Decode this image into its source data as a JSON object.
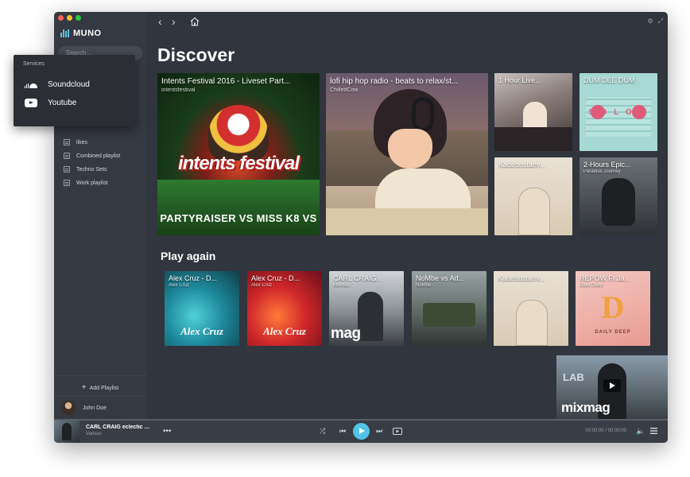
{
  "app": {
    "name": "MUNO",
    "search_placeholder": "Search..."
  },
  "colors": {
    "accent": "#4fc3e8",
    "window_bg": "#31353d",
    "sidebar_bg": "#353941"
  },
  "services_menu": {
    "title": "Services",
    "items": [
      {
        "label": "Soundcloud",
        "icon": "soundcloud-icon"
      },
      {
        "label": "Youtube",
        "icon": "youtube-icon"
      }
    ]
  },
  "sidebar": {
    "collection_label": "Your collection",
    "playlists": [
      {
        "label": "likes"
      },
      {
        "label": "Combined playlist"
      },
      {
        "label": "Techno Sets"
      },
      {
        "label": "Work playlist"
      }
    ],
    "add_playlist": "Add Playlist",
    "user_name": "John Doe"
  },
  "discover": {
    "heading": "Discover",
    "cards": [
      {
        "title": "Intents Festival 2016 - Liveset Part...",
        "subtitle": "intentsfestival",
        "art_text": "intents festival",
        "art_caption": "PARTYRAISER VS MISS K8 VS"
      },
      {
        "title": "lofi hip hop radio - beats to relax/st...",
        "subtitle": "ChilledCow"
      },
      {
        "title": "1 Hour Live...",
        "subtitle": ""
      },
      {
        "title": "DUM DEE DUM",
        "subtitle": "",
        "art_text": "S O L O W"
      },
      {
        "title": "Kadebostany...",
        "subtitle": ""
      },
      {
        "title": "2-Hours Epic...",
        "subtitle": "Paradise Journey"
      }
    ]
  },
  "play_again": {
    "heading": "Play again",
    "cards": [
      {
        "title": "Alex Cruz - D...",
        "subtitle": "Alex Cruz",
        "art_text": "Alex Cruz"
      },
      {
        "title": "Alex Cruz - D...",
        "subtitle": "Alex Cruz",
        "art_text": "Alex Cruz"
      },
      {
        "title": "CARL CRAIG...",
        "subtitle": "Mixmag",
        "art_text": "mag"
      },
      {
        "title": "NoMbe vs Ad...",
        "subtitle": "NoMbe"
      },
      {
        "title": "Kadebostany...",
        "subtitle": ""
      },
      {
        "title": "REPOW Ft Ja...",
        "subtitle": "Daily Deep",
        "art_text": "DAILY DEEP"
      }
    ]
  },
  "mini_player": {
    "brand": "mixmag",
    "tag": "LAB"
  },
  "now_playing": {
    "title": "CARL CRAIG eclectic m...",
    "artist": "Various",
    "time": "00:00:00 / 00:00:00",
    "progress": 0
  }
}
